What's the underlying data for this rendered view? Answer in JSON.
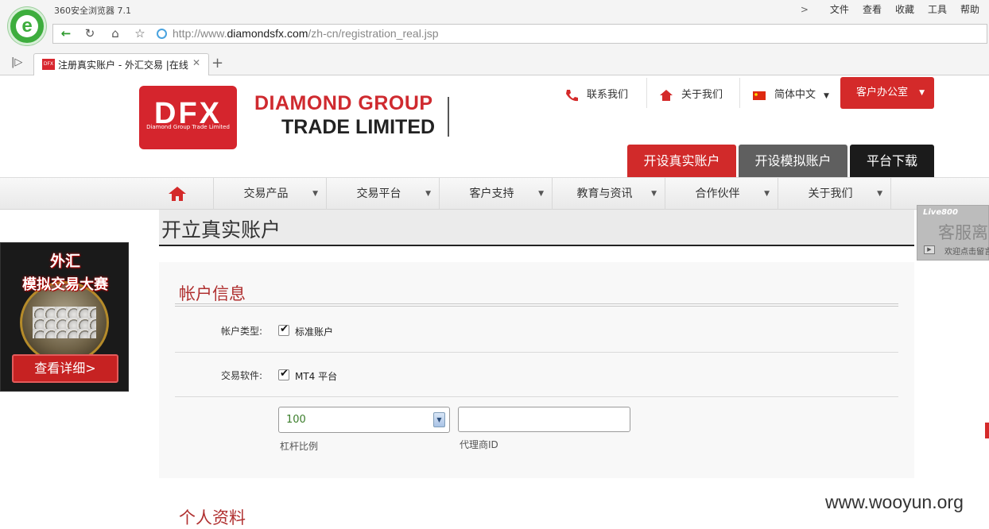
{
  "browser": {
    "title": "360安全浏览器 7.1",
    "menu": [
      "文件",
      "查看",
      "收藏",
      "工具",
      "帮助"
    ],
    "url_prefix": "http://www.",
    "url_domain": "diamondsfx.com",
    "url_path": "/zh-cn/registration_real.jsp",
    "tab_title": "注册真实账户 - 外汇交易 |在线",
    "tab_favicon": "DFX"
  },
  "header": {
    "logo_text": "DFX",
    "logo_sub": "Diamond Group Trade Limited",
    "brand_line1": "DIAMOND GROUP",
    "brand_line2": "TRADE LIMITED",
    "contact": "联系我们",
    "about": "关于我们",
    "language": "简体中文",
    "client_office": "客户办公室",
    "open_real": "开设真实账户",
    "open_demo": "开设模拟账户",
    "platform_download": "平台下载"
  },
  "nav": {
    "items": [
      "交易产品",
      "交易平台",
      "客户支持",
      "教育与资讯",
      "合作伙伴",
      "关于我们"
    ]
  },
  "page": {
    "title": "开立真实账户"
  },
  "promo": {
    "line1": "外汇",
    "line2": "模拟交易大赛",
    "button": "查看详细>"
  },
  "live800": {
    "brand": "Live800",
    "status": "客服离线",
    "cta": "欢迎点击留言"
  },
  "form": {
    "section_account": "帐户信息",
    "account_type_label": "帐户类型:",
    "account_type_value": "标准账户",
    "software_label": "交易软件:",
    "software_value": "MT4 平台",
    "leverage_value": "100",
    "leverage_label": "杠杆比例",
    "agent_label": "代理商ID",
    "agent_value": "",
    "section_personal": "个人资料"
  },
  "watermark": "www.wooyun.org",
  "colors": {
    "brand_red": "#d5252d",
    "demo_gray": "#5f5f5f",
    "download_black": "#1b1b1b",
    "section_red": "#b03030"
  }
}
